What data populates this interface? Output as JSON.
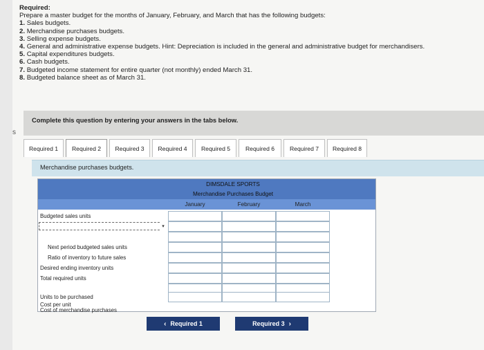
{
  "side_mark": "s",
  "requirements": {
    "heading": "Required:",
    "intro": "Prepare a master budget for the months of January, February, and March that has the following budgets:",
    "items": [
      {
        "num": "1.",
        "text": "Sales budgets."
      },
      {
        "num": "2.",
        "text": "Merchandise purchases budgets."
      },
      {
        "num": "3.",
        "text": "Selling expense budgets."
      },
      {
        "num": "4.",
        "text": "General and administrative expense budgets. Hint: Depreciation is included in the general and administrative budget for merchandisers."
      },
      {
        "num": "5.",
        "text": "Capital expenditures budgets."
      },
      {
        "num": "6.",
        "text": "Cash budgets."
      },
      {
        "num": "7.",
        "text": "Budgeted income statement for entire quarter (not monthly) ended March 31."
      },
      {
        "num": "8.",
        "text": "Budgeted balance sheet as of March 31."
      }
    ]
  },
  "instruction": "Complete this question by entering your answers in the tabs below.",
  "tabs": [
    "Required 1",
    "Required 2",
    "Required 3",
    "Required 4",
    "Required 5",
    "Required 6",
    "Required 7",
    "Required 8"
  ],
  "active_tab": "Required 2",
  "section_title": "Merchandise purchases budgets.",
  "table": {
    "company": "DIMSDALE SPORTS",
    "title": "Merchandise Purchases Budget",
    "columns": [
      "January",
      "February",
      "March"
    ],
    "rows": [
      {
        "label": "Budgeted sales units"
      },
      {
        "label": ""
      },
      {
        "label": ""
      },
      {
        "label": "Next period budgeted sales units"
      },
      {
        "label": "Ratio of inventory to future sales"
      },
      {
        "label": "Desired ending inventory units"
      },
      {
        "label": "Total required units"
      },
      {
        "label": ""
      },
      {
        "label": "Units to be purchased"
      },
      {
        "label": "Cost per unit"
      },
      {
        "label": "Cost of merchandise purchases"
      }
    ]
  },
  "nav": {
    "prev": "Required 1",
    "next": "Required 3",
    "prev_icon": "‹",
    "next_icon": "›"
  }
}
